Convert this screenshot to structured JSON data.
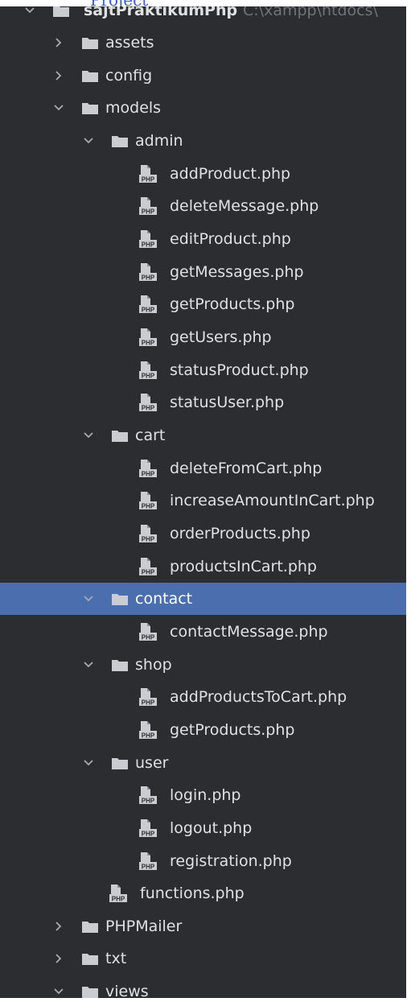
{
  "project": {
    "name": "sajtPraktikumPhp",
    "path": "C:\\xampp\\htdocs\\"
  },
  "tree": [
    {
      "label": "assets",
      "type": "folder",
      "expanded": false
    },
    {
      "label": "config",
      "type": "folder",
      "expanded": false
    },
    {
      "label": "models",
      "type": "folder",
      "expanded": true
    },
    {
      "label": "admin",
      "type": "folder",
      "expanded": true
    },
    {
      "label": "addProduct.php",
      "type": "php"
    },
    {
      "label": "deleteMessage.php",
      "type": "php"
    },
    {
      "label": "editProduct.php",
      "type": "php"
    },
    {
      "label": "getMessages.php",
      "type": "php"
    },
    {
      "label": "getProducts.php",
      "type": "php"
    },
    {
      "label": "getUsers.php",
      "type": "php"
    },
    {
      "label": "statusProduct.php",
      "type": "php"
    },
    {
      "label": "statusUser.php",
      "type": "php"
    },
    {
      "label": "cart",
      "type": "folder",
      "expanded": true
    },
    {
      "label": "deleteFromCart.php",
      "type": "php"
    },
    {
      "label": "increaseAmountInCart.php",
      "type": "php"
    },
    {
      "label": "orderProducts.php",
      "type": "php"
    },
    {
      "label": "productsInCart.php",
      "type": "php"
    },
    {
      "label": "contact",
      "type": "folder",
      "expanded": true,
      "selected": true
    },
    {
      "label": "contactMessage.php",
      "type": "php"
    },
    {
      "label": "shop",
      "type": "folder",
      "expanded": true
    },
    {
      "label": "addProductsToCart.php",
      "type": "php"
    },
    {
      "label": "getProducts.php",
      "type": "php"
    },
    {
      "label": "user",
      "type": "folder",
      "expanded": true
    },
    {
      "label": "login.php",
      "type": "php"
    },
    {
      "label": "logout.php",
      "type": "php"
    },
    {
      "label": "registration.php",
      "type": "php"
    },
    {
      "label": "functions.php",
      "type": "php"
    },
    {
      "label": "PHPMailer",
      "type": "folder",
      "expanded": false
    },
    {
      "label": "txt",
      "type": "folder",
      "expanded": false
    },
    {
      "label": "views",
      "type": "folder",
      "expanded": true
    }
  ],
  "icons": {
    "folder": "folder-icon",
    "php": "php-file-icon",
    "expanded": "chevron-down-icon",
    "collapsed": "chevron-right-icon"
  },
  "colors": {
    "background": "#2b2d30",
    "selection": "#4b6eaf",
    "text": "#dfe1e5",
    "muted": "#6f737a",
    "folder": "#c9ccd1"
  }
}
